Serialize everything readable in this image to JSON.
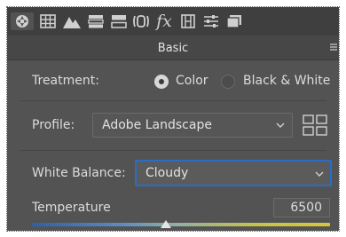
{
  "toolbar": {
    "tools": [
      {
        "name": "basic-panel-icon",
        "active": true
      },
      {
        "name": "tone-curve-icon"
      },
      {
        "name": "detail-icon"
      },
      {
        "name": "hsl-icon"
      },
      {
        "name": "split-toning-icon"
      },
      {
        "name": "lens-corrections-icon"
      },
      {
        "name": "effects-icon",
        "glyph": "fx"
      },
      {
        "name": "calibration-icon"
      },
      {
        "name": "presets-icon"
      },
      {
        "name": "snapshots-icon"
      }
    ]
  },
  "panel": {
    "title": "Basic"
  },
  "treatment": {
    "label": "Treatment:",
    "options": [
      "Color",
      "Black & White"
    ],
    "selected": "Color"
  },
  "profile": {
    "label": "Profile:",
    "value": "Adobe Landscape"
  },
  "white_balance": {
    "label": "White Balance:",
    "value": "Cloudy"
  },
  "temperature": {
    "label": "Temperature",
    "value": "6500",
    "slider_position": 0.455
  },
  "colors": {
    "accent": "#2b6cc4",
    "panel_bg": "#535353",
    "toolbar_bg": "#3f3f3f"
  }
}
